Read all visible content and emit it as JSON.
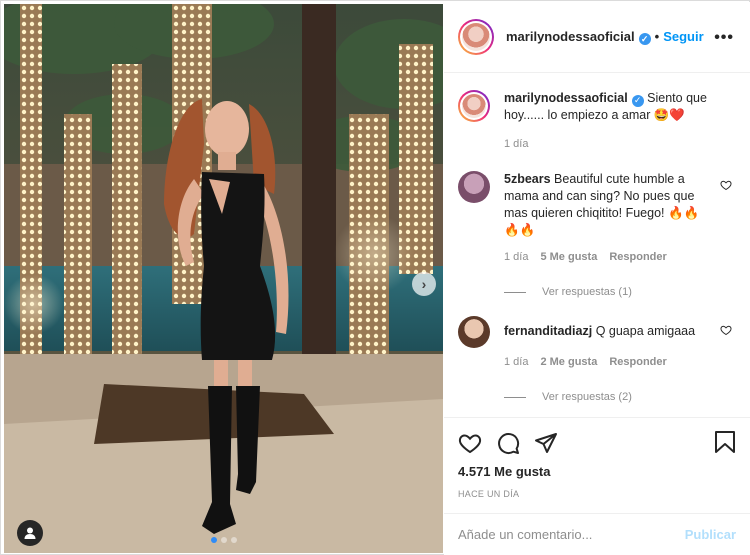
{
  "post": {
    "author": "marilynodessaoficial",
    "follow_label": "Seguir",
    "separator": "•",
    "caption_text": "Siento que hoy...... lo empiezo a amar 🤩❤️",
    "caption_time": "1 día",
    "likes": "4.571 Me gusta",
    "time_ago": "HACE UN DÍA"
  },
  "comments": [
    {
      "user": "5zbears",
      "text": "Beautiful cute humble a mama and can sing? No pues que mas quieren chiqitito! Fuego! 🔥🔥🔥🔥",
      "time": "1 día",
      "likes": "5 Me gusta",
      "reply_label": "Responder",
      "replies_label": "Ver respuestas (1)"
    },
    {
      "user": "fernanditadiazj",
      "text": "Q guapa amigaaa",
      "time": "1 día",
      "likes": "2 Me gusta",
      "reply_label": "Responder",
      "replies_label": "Ver respuestas (2)"
    }
  ],
  "add_comment": {
    "placeholder": "Añade un comentario...",
    "publish_label": "Publicar"
  },
  "icons": {
    "more": "more-options-icon",
    "verified": "verified-badge-icon",
    "like": "heart-icon",
    "comment": "comment-icon",
    "share": "share-icon",
    "save": "bookmark-icon",
    "user_tag": "user-tag-icon",
    "next": "chevron-right-icon"
  },
  "colors": {
    "accent": "#0095f6",
    "verified": "#3897f0",
    "muted": "#8e8e8e",
    "publish_disabled": "#b2dffc"
  }
}
